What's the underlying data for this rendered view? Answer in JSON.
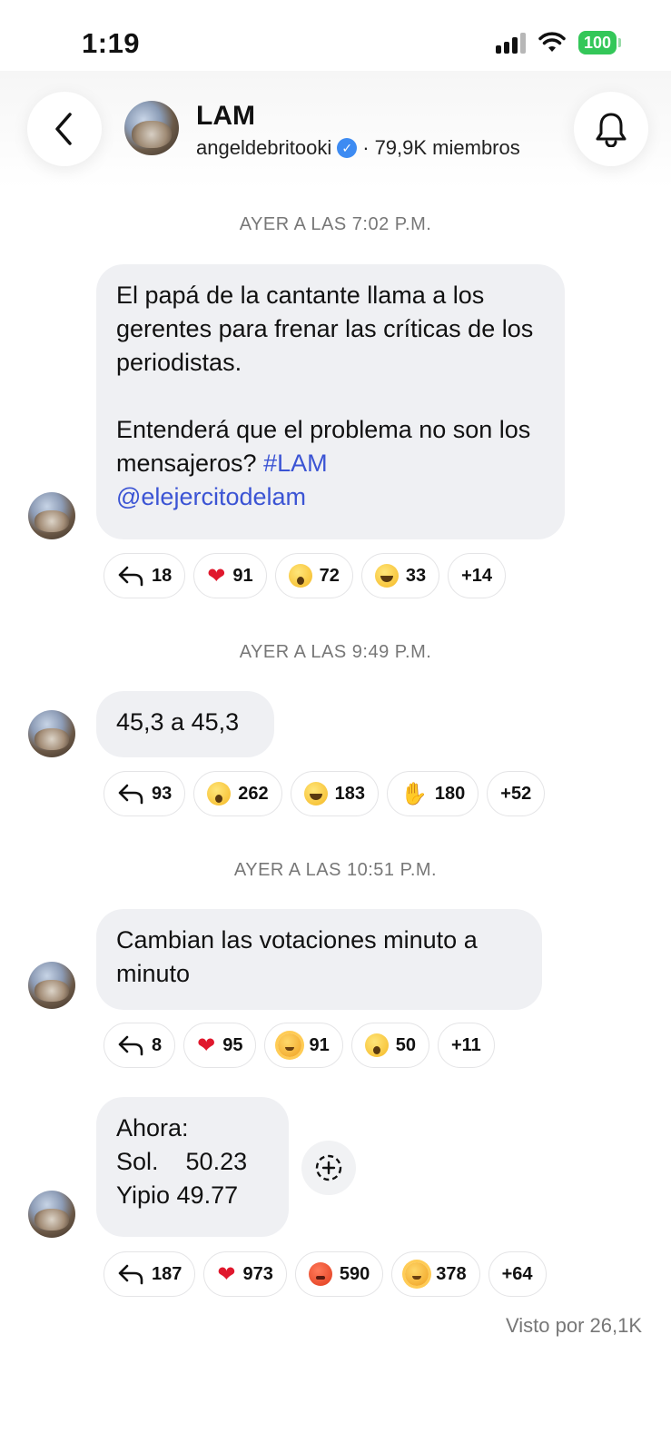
{
  "status_bar": {
    "time": "1:19",
    "battery": "100"
  },
  "header": {
    "title": "LAM",
    "owner": "angeldebritooki",
    "separator": "·",
    "members": "79,9K miembros",
    "icons": {
      "back": "chevron-left-icon",
      "bell": "bell-icon",
      "verified": "verified-badge-icon"
    }
  },
  "messages": [
    {
      "timestamp": "AYER A LAS 7:02 P.M.",
      "text_main": "El papá de la cantante llama a los gerentes para frenar las críticas de los periodistas.\n\nEntenderá que el problema no son los mensajeros? ",
      "hashtag": "#LAM",
      "mention": "@elejercitodelam",
      "reactions": [
        {
          "icon": "reply-icon",
          "count": "18"
        },
        {
          "icon": "heart",
          "count": "91"
        },
        {
          "icon": "wow",
          "count": "72"
        },
        {
          "icon": "laugh",
          "count": "33"
        },
        {
          "icon": "more",
          "count": "+14"
        }
      ]
    },
    {
      "timestamp": "AYER A LAS 9:49 P.M.",
      "text": "45,3 a 45,3",
      "reactions": [
        {
          "icon": "reply-icon",
          "count": "93"
        },
        {
          "icon": "wow",
          "count": "262"
        },
        {
          "icon": "laugh",
          "count": "183"
        },
        {
          "icon": "pinch",
          "count": "180"
        },
        {
          "icon": "more",
          "count": "+52"
        }
      ]
    },
    {
      "timestamp": "AYER A LAS 10:51 P.M.",
      "text": "Cambian las votaciones minuto a\nminuto",
      "reactions": [
        {
          "icon": "reply-icon",
          "count": "8"
        },
        {
          "icon": "heart",
          "count": "95"
        },
        {
          "icon": "sun",
          "count": "91"
        },
        {
          "icon": "wow",
          "count": "50"
        },
        {
          "icon": "more",
          "count": "+11"
        }
      ]
    },
    {
      "text": "Ahora:\nSol.    50.23\nYipio 49.77",
      "reactions": [
        {
          "icon": "reply-icon",
          "count": "187"
        },
        {
          "icon": "heart",
          "count": "973"
        },
        {
          "icon": "angry",
          "count": "590"
        },
        {
          "icon": "sun",
          "count": "378"
        },
        {
          "icon": "more",
          "count": "+64"
        }
      ]
    }
  ],
  "seen_by": "Visto por 26,1K"
}
